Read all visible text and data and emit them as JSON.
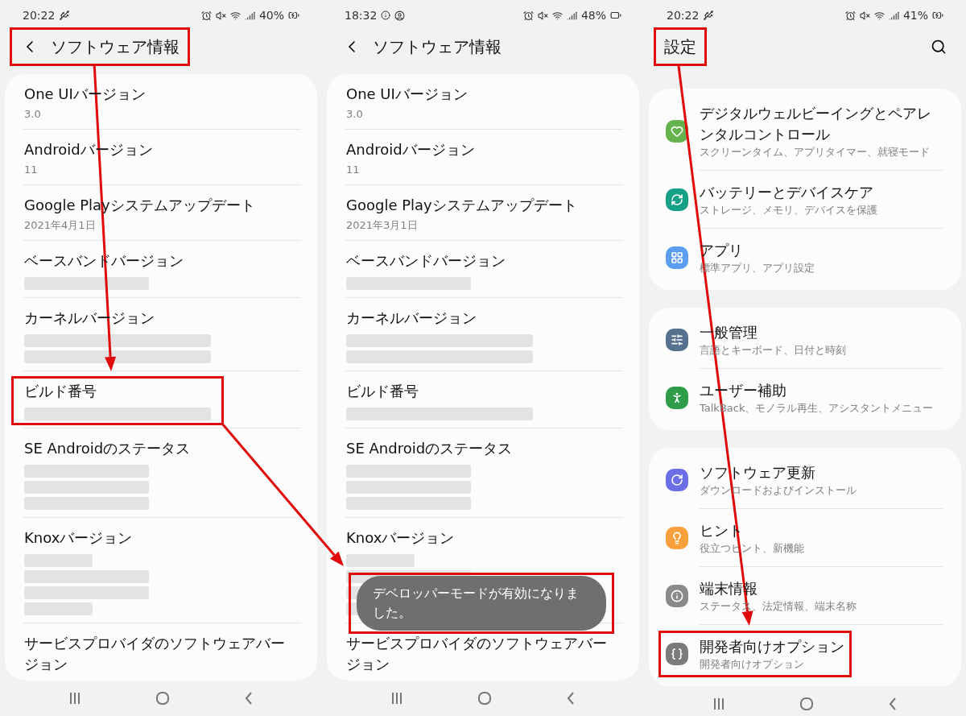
{
  "panels": [
    {
      "kind": "about",
      "status": {
        "time": "20:22",
        "battery": "40%",
        "charging": true
      },
      "header": {
        "title": "ソフトウェア情報",
        "highlighted": true,
        "arrow_to_next": true
      },
      "rows": [
        {
          "kind": "text",
          "title": "One UIバージョン",
          "value": "3.0",
          "highlighted": false
        },
        {
          "kind": "text",
          "title": "Androidバージョン",
          "value": "11",
          "highlighted": false
        },
        {
          "kind": "text",
          "title": "Google Playシステムアップデート",
          "value": "2021年4月1日",
          "highlighted": false
        },
        {
          "kind": "blurred",
          "title": "ベースバンドバージョン",
          "blurred_lines": [
            {
              "kind": "short"
            }
          ],
          "highlighted": false
        },
        {
          "kind": "blurred",
          "title": "カーネルバージョン",
          "blurred_lines": [
            {
              "kind": "long"
            },
            {
              "kind": "long"
            }
          ],
          "highlighted": false
        },
        {
          "kind": "blurred",
          "title": "ビルド番号",
          "blurred_lines": [
            {
              "kind": "long"
            }
          ],
          "highlighted": true,
          "arrow_to_next": true
        },
        {
          "kind": "blurred",
          "title": "SE Androidのステータス",
          "blurred_lines": [
            {
              "kind": "short"
            },
            {
              "kind": "short"
            },
            {
              "kind": "short"
            }
          ],
          "highlighted": false
        },
        {
          "kind": "blurred",
          "title": "Knoxバージョン",
          "blurred_lines": [
            {
              "kind": "tiny"
            },
            {
              "kind": "short"
            },
            {
              "kind": "short"
            },
            {
              "kind": "tiny"
            }
          ],
          "highlighted": false
        },
        {
          "kind": "title",
          "title": "サービスプロバイダのソフトウェアバージョン",
          "highlighted": false
        }
      ]
    },
    {
      "kind": "about",
      "status": {
        "time": "18:32",
        "battery": "48%",
        "charging": false
      },
      "header": {
        "title": "ソフトウェア情報",
        "highlighted": false
      },
      "rows": [
        {
          "kind": "text",
          "title": "One UIバージョン",
          "value": "3.0",
          "highlighted": false
        },
        {
          "kind": "text",
          "title": "Androidバージョン",
          "value": "11",
          "highlighted": false
        },
        {
          "kind": "text",
          "title": "Google Playシステムアップデート",
          "value": "2021年3月1日",
          "highlighted": false
        },
        {
          "kind": "blurred",
          "title": "ベースバンドバージョン",
          "blurred_lines": [
            {
              "kind": "short"
            }
          ],
          "highlighted": false
        },
        {
          "kind": "blurred",
          "title": "カーネルバージョン",
          "blurred_lines": [
            {
              "kind": "long"
            },
            {
              "kind": "long"
            }
          ],
          "highlighted": false
        },
        {
          "kind": "blurred",
          "title": "ビルド番号",
          "blurred_lines": [
            {
              "kind": "long"
            }
          ],
          "highlighted": false
        },
        {
          "kind": "blurred",
          "title": "SE Androidのステータス",
          "blurred_lines": [
            {
              "kind": "short"
            },
            {
              "kind": "short"
            },
            {
              "kind": "short"
            }
          ],
          "highlighted": false
        },
        {
          "kind": "blurred",
          "title": "Knoxバージョン",
          "blurred_lines": [
            {
              "kind": "tiny"
            },
            {
              "kind": "short"
            },
            {
              "kind": "short"
            },
            {
              "kind": "tiny"
            }
          ],
          "highlighted": false
        },
        {
          "kind": "title",
          "title": "サービスプロバイダのソフトウェアバージョン",
          "highlighted": false
        }
      ],
      "toast": {
        "text": "デベロッパーモードが有効になりました。",
        "highlighted": true
      }
    },
    {
      "kind": "settings",
      "status": {
        "time": "20:22",
        "battery": "41%",
        "charging": true
      },
      "header": {
        "title": "設定",
        "highlighted": true,
        "arrow_to_next": true
      },
      "groups": [
        {
          "items": [
            {
              "kind": "wellbeing",
              "title": "デジタルウェルビーイングとペアレンタルコントロール",
              "subtitle": "スクリーンタイム、アプリタイマー、就寝モード",
              "color": "#66b34e",
              "highlighted": false
            },
            {
              "kind": "battery",
              "title": "バッテリーとデバイスケア",
              "subtitle": "ストレージ、メモリ、デバイスを保護",
              "color": "#16a085",
              "highlighted": false
            },
            {
              "kind": "apps",
              "title": "アプリ",
              "subtitle": "標準アプリ、アプリ設定",
              "color": "#5b9ef0",
              "highlighted": false
            }
          ]
        },
        {
          "items": [
            {
              "kind": "sliders",
              "title": "一般管理",
              "subtitle": "言語とキーボード、日付と時刻",
              "color": "#56708f",
              "highlighted": false
            },
            {
              "kind": "accessibility",
              "title": "ユーザー補助",
              "subtitle": "TalkBack、モノラル再生、アシスタントメニュー",
              "color": "#2f9c4a",
              "highlighted": false
            }
          ]
        },
        {
          "items": [
            {
              "kind": "update",
              "title": "ソフトウェア更新",
              "subtitle": "ダウンロードおよびインストール",
              "color": "#6c6ee6",
              "highlighted": false
            },
            {
              "kind": "bulb",
              "title": "ヒント",
              "subtitle": "役立つヒント、新機能",
              "color": "#f7a03c",
              "highlighted": false
            },
            {
              "kind": "info",
              "title": "端末情報",
              "subtitle": "ステータス、法定情報、端末名称",
              "color": "#8a8a8a",
              "highlighted": false
            },
            {
              "kind": "braces",
              "title": "開発者向けオプション",
              "subtitle": "開発者向けオプション",
              "color": "#7b7b7b",
              "highlighted": true
            }
          ]
        }
      ]
    }
  ]
}
